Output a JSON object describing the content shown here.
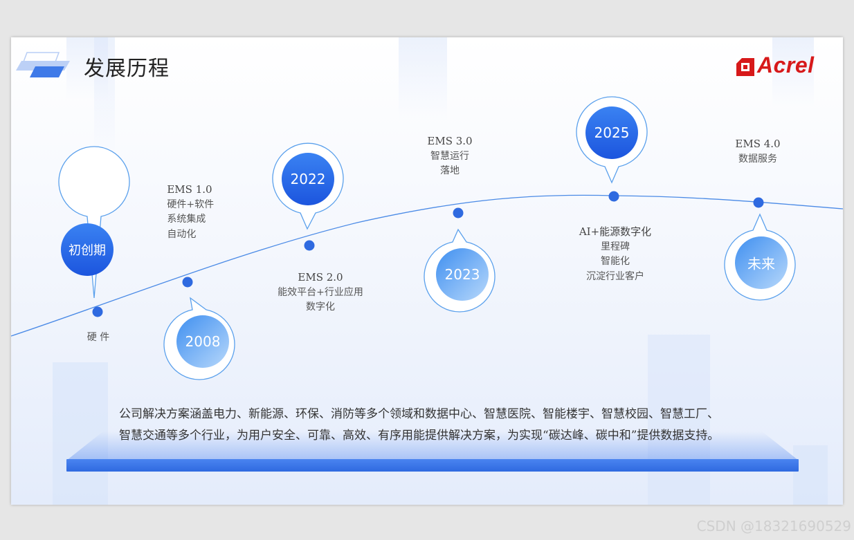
{
  "header": {
    "title": "发展历程",
    "logo_text": "Acrel"
  },
  "milestones": [
    {
      "pin": "初创期",
      "lines": [
        "硬 件"
      ]
    },
    {
      "pin": "2008",
      "head": "EMS 1.0",
      "lines": [
        "硬件+软件",
        "系统集成",
        "自动化"
      ]
    },
    {
      "pin": "2022",
      "head": "EMS 2.0",
      "lines": [
        "能效平台+行业应用",
        "数字化"
      ]
    },
    {
      "pin": "2023",
      "head": "EMS 3.0",
      "lines": [
        "智慧运行",
        "落地"
      ]
    },
    {
      "pin": "2025",
      "head": "AI+能源数字化",
      "lines": [
        "里程碑",
        "智能化",
        "沉淀行业客户"
      ]
    },
    {
      "pin": "未来",
      "head": "EMS 4.0",
      "lines": [
        "数据服务"
      ]
    }
  ],
  "description": {
    "line1": "公司解决方案涵盖电力、新能源、环保、消防等多个领域和数据中心、智慧医院、智能楼宇、智慧校园、智慧工厂、",
    "line2": "智慧交通等多个行业，为用户安全、可靠、高效、有序用能提供解决方案，为实现“碳达峰、碳中和”提供数据支持。"
  },
  "watermark": "CSDN @18321690529",
  "colors": {
    "accent": "#2f6ae0",
    "brand": "#d7191a"
  }
}
